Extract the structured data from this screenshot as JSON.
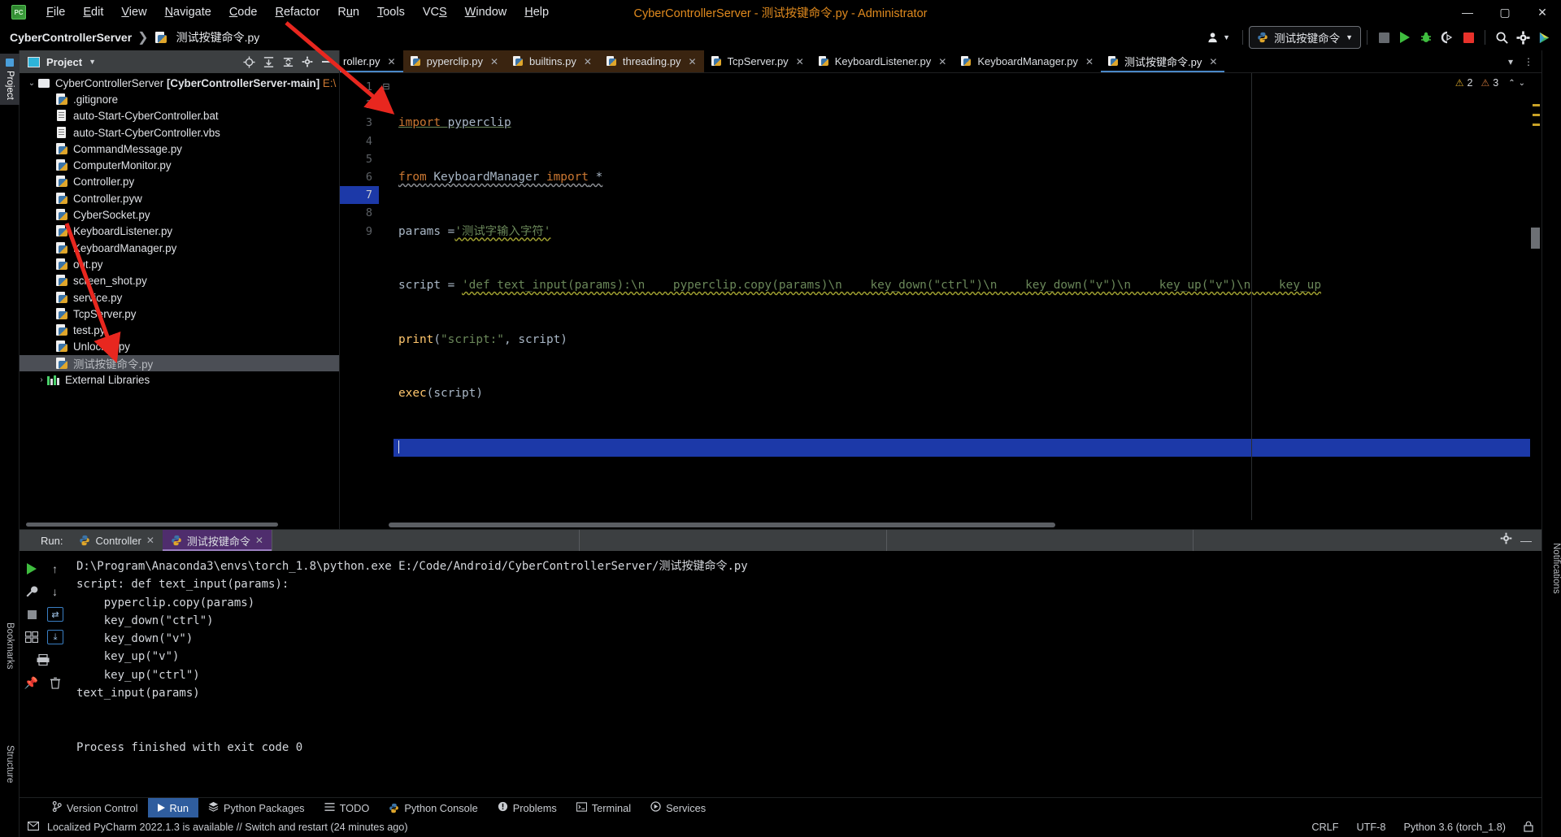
{
  "window": {
    "title": "CyberControllerServer - 测试按键命令.py - Administrator",
    "logo": "pycharm-logo",
    "minimize": "—",
    "maximize": "▢",
    "close": "✕"
  },
  "menu": [
    {
      "label": "File"
    },
    {
      "label": "Edit"
    },
    {
      "label": "View"
    },
    {
      "label": "Navigate"
    },
    {
      "label": "Code"
    },
    {
      "label": "Refactor"
    },
    {
      "label": "Run"
    },
    {
      "label": "Tools"
    },
    {
      "label": "VCS"
    },
    {
      "label": "Window"
    },
    {
      "label": "Help"
    }
  ],
  "navbar": {
    "project_name": "CyberControllerServer",
    "separator": "❯",
    "current_file": "测试按键命令.py",
    "account_icon": "user-icon",
    "run_config": "测试按键命令",
    "run_config_caret": "▼",
    "buttons": [
      {
        "name": "stop-grey",
        "glyph": "■"
      },
      {
        "name": "run",
        "glyph": "▶"
      },
      {
        "name": "debug",
        "glyph": "🐞"
      },
      {
        "name": "run-coverage",
        "glyph": "◖"
      },
      {
        "name": "stop",
        "glyph": "■"
      },
      {
        "name": "search",
        "glyph": "🔍"
      },
      {
        "name": "settings",
        "glyph": "⚙"
      },
      {
        "name": "update-ide",
        "glyph": "▶"
      }
    ]
  },
  "left_strip": {
    "project_tab": "Project",
    "structure_tab": "Structure",
    "bookmarks_tab": "Bookmarks"
  },
  "right_strip": {
    "notifications_tab": "Notifications"
  },
  "project_panel": {
    "title": "Project",
    "title_caret": "▼",
    "icons": [
      "locate-icon",
      "expand-all-icon",
      "collapse-all-icon",
      "settings-icon",
      "hide-icon"
    ],
    "tree": [
      {
        "depth": 0,
        "arrow": "⌄",
        "icon": "folder",
        "label": "CyberControllerServer",
        "bracket": " [CyberControllerServer-main]",
        "path": " E:\\",
        "selected": false
      },
      {
        "depth": 1,
        "arrow": "",
        "icon": "py",
        "label": ".gitignore",
        "selected": false
      },
      {
        "depth": 1,
        "arrow": "",
        "icon": "txt",
        "label": "auto-Start-CyberController.bat",
        "selected": false
      },
      {
        "depth": 1,
        "arrow": "",
        "icon": "txt",
        "label": "auto-Start-CyberController.vbs",
        "selected": false
      },
      {
        "depth": 1,
        "arrow": "",
        "icon": "py",
        "label": "CommandMessage.py",
        "selected": false
      },
      {
        "depth": 1,
        "arrow": "",
        "icon": "py",
        "label": "ComputerMonitor.py",
        "selected": false
      },
      {
        "depth": 1,
        "arrow": "",
        "icon": "py",
        "label": "Controller.py",
        "selected": false
      },
      {
        "depth": 1,
        "arrow": "",
        "icon": "py",
        "label": "Controller.pyw",
        "selected": false
      },
      {
        "depth": 1,
        "arrow": "",
        "icon": "py",
        "label": "CyberSocket.py",
        "selected": false
      },
      {
        "depth": 1,
        "arrow": "",
        "icon": "py",
        "label": "KeyboardListener.py",
        "selected": false
      },
      {
        "depth": 1,
        "arrow": "",
        "icon": "py",
        "label": "KeyboardManager.py",
        "selected": false
      },
      {
        "depth": 1,
        "arrow": "",
        "icon": "py",
        "label": "out.py",
        "selected": false
      },
      {
        "depth": 1,
        "arrow": "",
        "icon": "py",
        "label": "screen_shot.py",
        "selected": false
      },
      {
        "depth": 1,
        "arrow": "",
        "icon": "py",
        "label": "service.py",
        "selected": false
      },
      {
        "depth": 1,
        "arrow": "",
        "icon": "py",
        "label": "TcpServer.py",
        "selected": false
      },
      {
        "depth": 1,
        "arrow": "",
        "icon": "py",
        "label": "test.py",
        "selected": false
      },
      {
        "depth": 1,
        "arrow": "",
        "icon": "py",
        "label": "Unlocker.py",
        "selected": false
      },
      {
        "depth": 1,
        "arrow": "",
        "icon": "py",
        "label": "测试按键命令.py",
        "selected": true
      },
      {
        "depth": 0,
        "arrow": "›",
        "icon": "lib",
        "label": "External Libraries",
        "selected": false
      }
    ]
  },
  "editor": {
    "tabs": [
      {
        "label": "roller.py",
        "active": false,
        "close": "✕",
        "truncated": true
      },
      {
        "label": "pyperclip.py",
        "active": false,
        "close": "✕"
      },
      {
        "label": "builtins.py",
        "active": false,
        "close": "✕"
      },
      {
        "label": "threading.py",
        "active": false,
        "close": "✕"
      },
      {
        "label": "TcpServer.py",
        "active": false,
        "close": "✕"
      },
      {
        "label": "KeyboardListener.py",
        "active": false,
        "close": "✕"
      },
      {
        "label": "KeyboardManager.py",
        "active": false,
        "close": "✕"
      },
      {
        "label": "测试按键命令.py",
        "active": true,
        "close": "✕"
      }
    ],
    "tabs_overflow_caret": "▾",
    "tabs_menu": "⋮",
    "inspection": {
      "warning_icon": "warning-triangle",
      "warning_count": "2",
      "error_icon": "error-triangle",
      "error_count": "3",
      "up_caret": "⌃",
      "down_caret": "⌄"
    },
    "lines": [
      {
        "no": "1",
        "fold": "⊟",
        "current": false
      },
      {
        "no": "2",
        "fold": "⊟",
        "current": false
      },
      {
        "no": "3",
        "fold": "",
        "current": false
      },
      {
        "no": "4",
        "fold": "",
        "current": false
      },
      {
        "no": "5",
        "fold": "",
        "current": false
      },
      {
        "no": "6",
        "fold": "",
        "current": false
      },
      {
        "no": "7",
        "fold": "",
        "current": true
      },
      {
        "no": "8",
        "fold": "",
        "current": false
      },
      {
        "no": "9",
        "fold": "",
        "current": false
      }
    ],
    "code": {
      "l1_kw": "import",
      "l1_mod": " pyperclip",
      "l2_kw": "from",
      "l2_mod": " KeyboardManager ",
      "l2_kw2": "import",
      "l2_star": " *",
      "l3_var": "params ",
      "l3_eq": "=",
      "l3_str": "'测试字输入字符'",
      "l4_var": "script ",
      "l4_eq": "= ",
      "l4_str": "'def text_input(params):\\n    pyperclip.copy(params)\\n    key_down(\"ctrl\")\\n    key_down(\"v\")\\n    key_up(\"v\")\\n    key_up",
      "l5_fn": "print",
      "l5_open": "(",
      "l5_str": "\"script:\"",
      "l5_comma": ", ",
      "l5_arg": "script",
      "l5_close": ")",
      "l6_fn": "exec",
      "l6_open": "(",
      "l6_arg": "script",
      "l6_close": ")"
    }
  },
  "run_panel": {
    "label": "Run:",
    "tabs": [
      {
        "label": "Controller",
        "active": false,
        "close": "✕"
      },
      {
        "label": "测试按键命令",
        "active": true,
        "close": "✕"
      }
    ],
    "settings_icon": "gear-icon",
    "hide_icon": "—",
    "sidebar_icons": [
      "run-icon",
      "up-arrow-icon",
      "wrench-icon",
      "down-arrow-icon",
      "stop-icon",
      "wrap-icon",
      "layout-icon",
      "scroll-end-icon",
      "print-icon",
      "pin-icon",
      "trash-icon"
    ],
    "console": "D:\\Program\\Anaconda3\\envs\\torch_1.8\\python.exe E:/Code/Android/CyberControllerServer/测试按键命令.py\nscript: def text_input(params):\n    pyperclip.copy(params)\n    key_down(\"ctrl\")\n    key_down(\"v\")\n    key_up(\"v\")\n    key_up(\"ctrl\")\ntext_input(params)\n\n\nProcess finished with exit code 0"
  },
  "bottom_tabs": [
    {
      "label": "Version Control",
      "icon": "branch-icon",
      "active": false
    },
    {
      "label": "Run",
      "icon": "run-icon",
      "active": true
    },
    {
      "label": "Python Packages",
      "icon": "packages-icon",
      "active": false
    },
    {
      "label": "TODO",
      "icon": "todo-icon",
      "active": false
    },
    {
      "label": "Python Console",
      "icon": "python-icon",
      "active": false
    },
    {
      "label": "Problems",
      "icon": "problems-icon",
      "active": false
    },
    {
      "label": "Terminal",
      "icon": "terminal-icon",
      "active": false
    },
    {
      "label": "Services",
      "icon": "services-icon",
      "active": false
    }
  ],
  "status_bar": {
    "icon": "message-icon",
    "message": "Localized PyCharm 2022.1.3 is available // Switch and restart (24 minutes ago)",
    "line_sep": "CRLF",
    "encoding": "UTF-8",
    "interpreter": "Python 3.6 (torch_1.8)",
    "lock_icon": "lock-icon"
  },
  "colors": {
    "accent_blue": "#1c39a8",
    "title_orange": "#e08a1e",
    "tab_brown": "#3a2410",
    "run_tab_purple": "#4f2d6d",
    "string_green": "#6a8759",
    "keyword_orange": "#cc7832",
    "annotation_red": "#e8271f"
  }
}
